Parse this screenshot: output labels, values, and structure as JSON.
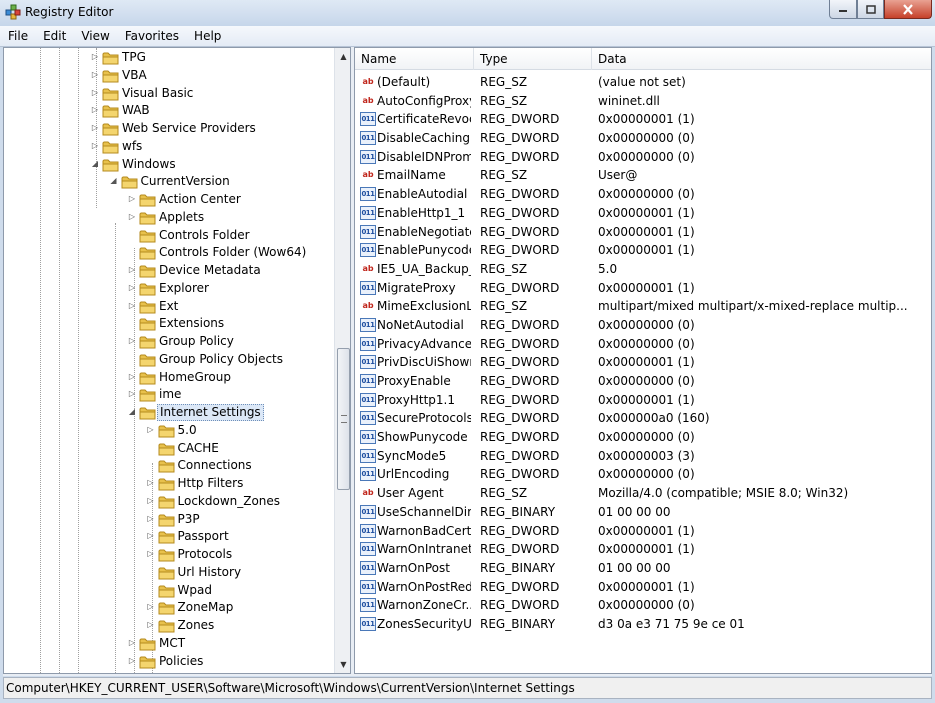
{
  "window": {
    "title": "Registry Editor"
  },
  "menu": [
    "File",
    "Edit",
    "View",
    "Favorites",
    "Help"
  ],
  "tree": [
    {
      "label": "TPG",
      "level": 2,
      "expander": "collapsed"
    },
    {
      "label": "VBA",
      "level": 2,
      "expander": "collapsed"
    },
    {
      "label": "Visual Basic",
      "level": 2,
      "expander": "collapsed"
    },
    {
      "label": "WAB",
      "level": 2,
      "expander": "collapsed"
    },
    {
      "label": "Web Service Providers",
      "level": 2,
      "expander": "collapsed"
    },
    {
      "label": "wfs",
      "level": 2,
      "expander": "collapsed"
    },
    {
      "label": "Windows",
      "level": 2,
      "expander": "expanded"
    },
    {
      "label": "CurrentVersion",
      "level": 3,
      "expander": "expanded"
    },
    {
      "label": "Action Center",
      "level": 4,
      "expander": "collapsed"
    },
    {
      "label": "Applets",
      "level": 4,
      "expander": "collapsed"
    },
    {
      "label": "Controls Folder",
      "level": 4,
      "expander": "none"
    },
    {
      "label": "Controls Folder (Wow64)",
      "level": 4,
      "expander": "none"
    },
    {
      "label": "Device Metadata",
      "level": 4,
      "expander": "collapsed"
    },
    {
      "label": "Explorer",
      "level": 4,
      "expander": "collapsed"
    },
    {
      "label": "Ext",
      "level": 4,
      "expander": "collapsed"
    },
    {
      "label": "Extensions",
      "level": 4,
      "expander": "none"
    },
    {
      "label": "Group Policy",
      "level": 4,
      "expander": "collapsed"
    },
    {
      "label": "Group Policy Objects",
      "level": 4,
      "expander": "none"
    },
    {
      "label": "HomeGroup",
      "level": 4,
      "expander": "collapsed"
    },
    {
      "label": "ime",
      "level": 4,
      "expander": "collapsed"
    },
    {
      "label": "Internet Settings",
      "level": 4,
      "expander": "expanded",
      "selected": true
    },
    {
      "label": "5.0",
      "level": 5,
      "expander": "collapsed"
    },
    {
      "label": "CACHE",
      "level": 5,
      "expander": "none"
    },
    {
      "label": "Connections",
      "level": 5,
      "expander": "none"
    },
    {
      "label": "Http Filters",
      "level": 5,
      "expander": "collapsed"
    },
    {
      "label": "Lockdown_Zones",
      "level": 5,
      "expander": "collapsed"
    },
    {
      "label": "P3P",
      "level": 5,
      "expander": "collapsed"
    },
    {
      "label": "Passport",
      "level": 5,
      "expander": "collapsed"
    },
    {
      "label": "Protocols",
      "level": 5,
      "expander": "collapsed"
    },
    {
      "label": "Url History",
      "level": 5,
      "expander": "none"
    },
    {
      "label": "Wpad",
      "level": 5,
      "expander": "none"
    },
    {
      "label": "ZoneMap",
      "level": 5,
      "expander": "collapsed"
    },
    {
      "label": "Zones",
      "level": 5,
      "expander": "collapsed"
    },
    {
      "label": "MCT",
      "level": 4,
      "expander": "collapsed"
    },
    {
      "label": "Policies",
      "level": 4,
      "expander": "collapsed"
    }
  ],
  "list": {
    "columns": [
      "Name",
      "Type",
      "Data"
    ],
    "rows": [
      {
        "icon": "string-value-icon",
        "name": "(Default)",
        "type": "REG_SZ",
        "data": "(value not set)"
      },
      {
        "icon": "string-value-icon",
        "name": "AutoConfigProxy",
        "type": "REG_SZ",
        "data": "wininet.dll"
      },
      {
        "icon": "binary-value-icon",
        "name": "CertificateRevoc...",
        "type": "REG_DWORD",
        "data": "0x00000001 (1)"
      },
      {
        "icon": "binary-value-icon",
        "name": "DisableCaching...",
        "type": "REG_DWORD",
        "data": "0x00000000 (0)"
      },
      {
        "icon": "binary-value-icon",
        "name": "DisableIDNProm...",
        "type": "REG_DWORD",
        "data": "0x00000000 (0)"
      },
      {
        "icon": "string-value-icon",
        "name": "EmailName",
        "type": "REG_SZ",
        "data": "User@"
      },
      {
        "icon": "binary-value-icon",
        "name": "EnableAutodial",
        "type": "REG_DWORD",
        "data": "0x00000000 (0)"
      },
      {
        "icon": "binary-value-icon",
        "name": "EnableHttp1_1",
        "type": "REG_DWORD",
        "data": "0x00000001 (1)"
      },
      {
        "icon": "binary-value-icon",
        "name": "EnableNegotiate",
        "type": "REG_DWORD",
        "data": "0x00000001 (1)"
      },
      {
        "icon": "binary-value-icon",
        "name": "EnablePunycode",
        "type": "REG_DWORD",
        "data": "0x00000001 (1)"
      },
      {
        "icon": "string-value-icon",
        "name": "IE5_UA_Backup_...",
        "type": "REG_SZ",
        "data": "5.0"
      },
      {
        "icon": "binary-value-icon",
        "name": "MigrateProxy",
        "type": "REG_DWORD",
        "data": "0x00000001 (1)"
      },
      {
        "icon": "string-value-icon",
        "name": "MimeExclusionL...",
        "type": "REG_SZ",
        "data": "multipart/mixed multipart/x-mixed-replace multip..."
      },
      {
        "icon": "binary-value-icon",
        "name": "NoNetAutodial",
        "type": "REG_DWORD",
        "data": "0x00000000 (0)"
      },
      {
        "icon": "binary-value-icon",
        "name": "PrivacyAdvanced",
        "type": "REG_DWORD",
        "data": "0x00000000 (0)"
      },
      {
        "icon": "binary-value-icon",
        "name": "PrivDiscUiShown",
        "type": "REG_DWORD",
        "data": "0x00000001 (1)"
      },
      {
        "icon": "binary-value-icon",
        "name": "ProxyEnable",
        "type": "REG_DWORD",
        "data": "0x00000000 (0)"
      },
      {
        "icon": "binary-value-icon",
        "name": "ProxyHttp1.1",
        "type": "REG_DWORD",
        "data": "0x00000001 (1)"
      },
      {
        "icon": "binary-value-icon",
        "name": "SecureProtocols",
        "type": "REG_DWORD",
        "data": "0x000000a0 (160)"
      },
      {
        "icon": "binary-value-icon",
        "name": "ShowPunycode",
        "type": "REG_DWORD",
        "data": "0x00000000 (0)"
      },
      {
        "icon": "binary-value-icon",
        "name": "SyncMode5",
        "type": "REG_DWORD",
        "data": "0x00000003 (3)"
      },
      {
        "icon": "binary-value-icon",
        "name": "UrlEncoding",
        "type": "REG_DWORD",
        "data": "0x00000000 (0)"
      },
      {
        "icon": "string-value-icon",
        "name": "User Agent",
        "type": "REG_SZ",
        "data": "Mozilla/4.0 (compatible; MSIE 8.0; Win32)"
      },
      {
        "icon": "binary-value-icon",
        "name": "UseSchannelDir...",
        "type": "REG_BINARY",
        "data": "01 00 00 00"
      },
      {
        "icon": "binary-value-icon",
        "name": "WarnonBadCert...",
        "type": "REG_DWORD",
        "data": "0x00000001 (1)"
      },
      {
        "icon": "binary-value-icon",
        "name": "WarnOnIntranet",
        "type": "REG_DWORD",
        "data": "0x00000001 (1)"
      },
      {
        "icon": "binary-value-icon",
        "name": "WarnOnPost",
        "type": "REG_BINARY",
        "data": "01 00 00 00"
      },
      {
        "icon": "binary-value-icon",
        "name": "WarnOnPostRed...",
        "type": "REG_DWORD",
        "data": "0x00000001 (1)"
      },
      {
        "icon": "binary-value-icon",
        "name": "WarnonZoneCr...",
        "type": "REG_DWORD",
        "data": "0x00000000 (0)"
      },
      {
        "icon": "binary-value-icon",
        "name": "ZonesSecurityU...",
        "type": "REG_BINARY",
        "data": "d3 0a e3 71 75 9e ce 01"
      }
    ]
  },
  "status": {
    "path": "Computer\\HKEY_CURRENT_USER\\Software\\Microsoft\\Windows\\CurrentVersion\\Internet Settings"
  }
}
